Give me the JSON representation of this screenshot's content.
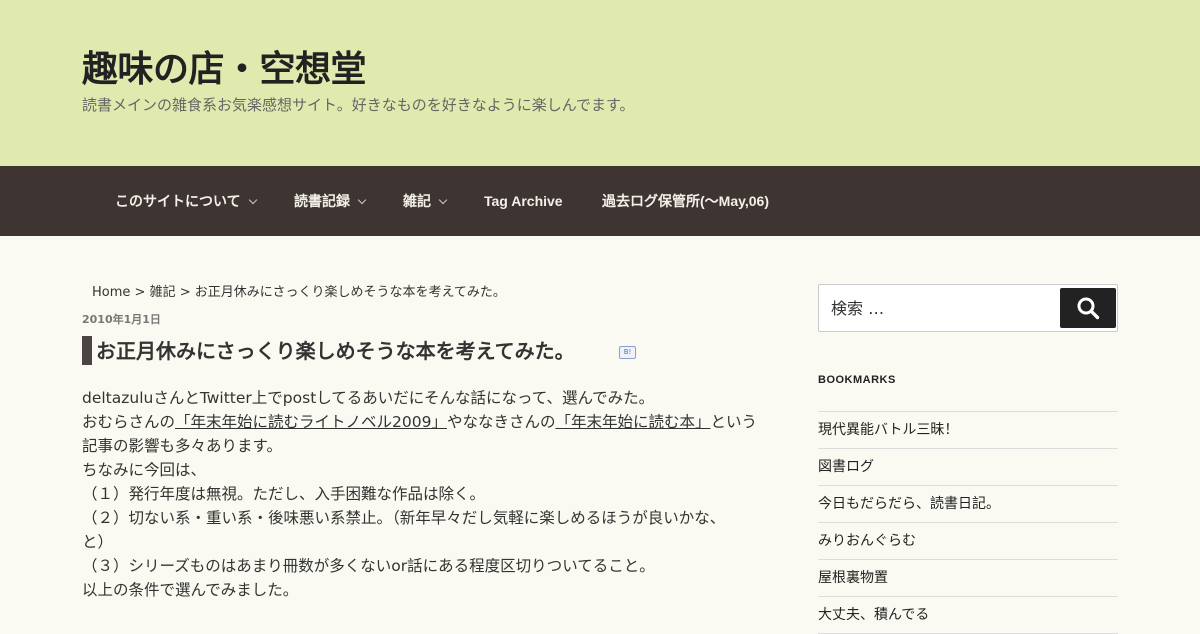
{
  "site": {
    "title": "趣味の店・空想堂",
    "description": "読書メインの雑食系お気楽感想サイト。好きなものを好きなように楽しんでます。"
  },
  "nav": {
    "items": [
      {
        "label": "このサイトについて",
        "has_submenu": true
      },
      {
        "label": "読書記録",
        "has_submenu": true
      },
      {
        "label": "雑記",
        "has_submenu": true
      },
      {
        "label": "Tag Archive",
        "has_submenu": false
      },
      {
        "label": "過去ログ保管所(～May,06)",
        "has_submenu": false
      }
    ]
  },
  "breadcrumb": {
    "home": "Home",
    "sep": " > ",
    "category": "雑記",
    "current": "お正月休みにさっくり楽しめそうな本を考えてみた。"
  },
  "post": {
    "date": "2010年1月1日",
    "title": "お正月休みにさっくり楽しめそうな本を考えてみた。",
    "line1": "deltazuluさんとTwitter上でpostしてるあいだにそんな話になって、選んでみた。",
    "line2_a": "おむらさんの",
    "line2_link1": "「年末年始に読むライトノベル2009」",
    "line2_b": "やななきさんの",
    "line2_link2": "「年末年始に読む本」",
    "line2_c": "という",
    "line3": "記事の影響も多々あります。",
    "line4": "ちなみに今回は、",
    "line5": "（１）発行年度は無視。ただし、入手困難な作品は除く。",
    "line6": "（２）切ない系・重い系・後味悪い系禁止。（新年早々だし気軽に楽しめるほうが良いかな、",
    "line7": "と）",
    "line8": "（３）シリーズものはあまり冊数が多くないor話にある程度区切りついてること。",
    "line9": "以上の条件で選んでみました。"
  },
  "search": {
    "placeholder": "検索 …"
  },
  "bookmarks": {
    "title": "BOOKMARKS",
    "items": [
      "現代異能バトル三昧！",
      "図書ログ",
      "今日もだらだら、読書日記。",
      "みりおんぐらむ",
      "屋根裏物置",
      "大丈夫、積んでる"
    ]
  }
}
